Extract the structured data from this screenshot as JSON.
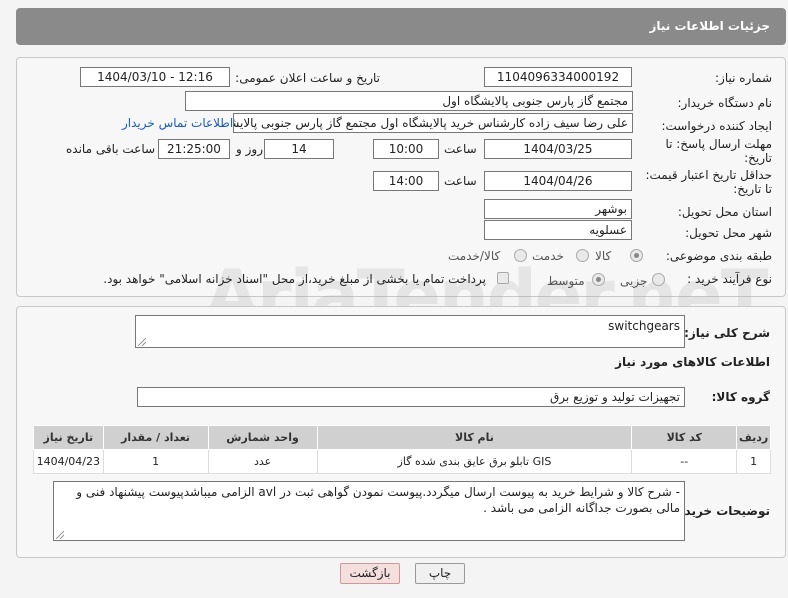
{
  "header": {
    "title": "جزئیات اطلاعات نیاز"
  },
  "form": {
    "need_number_label": "شماره نیاز:",
    "need_number": "1104096334000192",
    "announce_label": "تاریخ و ساعت اعلان عمومی:",
    "announce_value": "1404/03/10 - 12:16",
    "buyer_org_label": "نام دستگاه خریدار:",
    "buyer_org": "مجتمع گاز پارس جنوبی  پالایشگاه اول",
    "creator_label": "ایجاد کننده درخواست:",
    "creator": "علی رضا سیف زاده کارشناس خرید پالایشگاه اول مجتمع گاز پارس جنوبی  پالایشگاه اول",
    "contact_link": "اطلاعات تماس خریدار",
    "deadline_label_1": "مهلت ارسال پاسخ: تا",
    "deadline_label_2": "تاریخ:",
    "deadline_date": "1404/03/25",
    "time_label": "ساعت",
    "deadline_time": "10:00",
    "days_value": "14",
    "days_label": "روز و",
    "remaining_time": "21:25:00",
    "remaining_label": "ساعت باقی مانده",
    "validity_label_1": "حداقل تاریخ اعتبار قیمت:",
    "validity_label_2": "تا تاریخ:",
    "validity_date": "1404/04/26",
    "validity_time": "14:00",
    "province_label": "استان محل تحویل:",
    "province": "بوشهر",
    "city_label": "شهر محل تحویل:",
    "city": "عسلویه",
    "category_label": "طبقه بندی موضوعی:",
    "category_options": [
      "کالا",
      "خدمت",
      "کالا/خدمت"
    ],
    "process_label": "نوع فرآیند خرید :",
    "process_options": [
      "جزیی",
      "متوسط"
    ],
    "payment_note": "پرداخت تمام یا بخشی از مبلغ خرید،از محل \"اسناد خزانه اسلامی\" خواهد بود."
  },
  "goods": {
    "desc_label": "شرح کلی نیاز:",
    "desc_value": "switchgears",
    "section_title": "اطلاعات کالاهای مورد نیاز",
    "group_label": "گروه کالا:",
    "group_value": "تجهیزات تولید و توزیع برق",
    "table": {
      "headers": [
        "ردیف",
        "کد کالا",
        "نام کالا",
        "واحد شمارش",
        "تعداد / مقدار",
        "تاریخ نیاز"
      ],
      "rows": [
        [
          "1",
          "--",
          "تابلو برق عایق بندی شده گاز GIS",
          "عدد",
          "1",
          "1404/04/23"
        ]
      ]
    },
    "buyer_notes_label": "توضیحات خریدار:",
    "buyer_notes": "-  شرح کالا و شرایط خرید به پیوست ارسال میگردد.پیوست نمودن گواهی ثبت در avl الزامی میباشدپیوست پیشنهاد فنی و مالی بصورت جداگانه الزامی می باشد ."
  },
  "buttons": {
    "print": "چاپ",
    "back": "بازگشت"
  },
  "watermark": "AriaTender.neT"
}
